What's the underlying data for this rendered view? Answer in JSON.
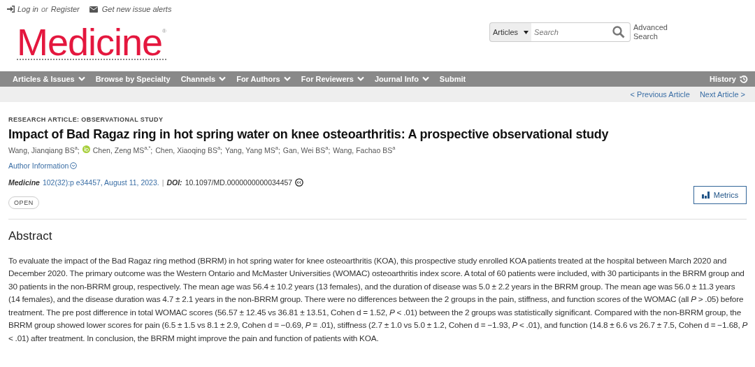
{
  "top_links": {
    "login": "Log in",
    "or": "or",
    "register": "Register",
    "alerts": "Get new issue alerts"
  },
  "logo": {
    "name": "Medicine",
    "mark": "®"
  },
  "search": {
    "scope": "Articles",
    "placeholder": "Search",
    "advanced": "Advanced Search"
  },
  "nav": {
    "items": [
      {
        "label": "Articles & Issues",
        "dropdown": true
      },
      {
        "label": "Browse by Specialty",
        "dropdown": false
      },
      {
        "label": "Channels",
        "dropdown": true
      },
      {
        "label": "For Authors",
        "dropdown": true
      },
      {
        "label": "For Reviewers",
        "dropdown": true
      },
      {
        "label": "Journal Info",
        "dropdown": true
      },
      {
        "label": "Submit",
        "dropdown": false
      }
    ],
    "history": "History"
  },
  "pager": {
    "previous": "< Previous Article",
    "next": "Next Article >"
  },
  "article": {
    "type": "RESEARCH ARTICLE: OBSERVATIONAL STUDY",
    "title": "Impact of Bad Ragaz ring in hot spring water on knee osteoarthritis: A prospective observational study",
    "authors": [
      {
        "name": "Wang, Jianqiang BS$^{a}$;",
        "orcid": false
      },
      {
        "name": "Chen, Zeng MS$^{a,*}$;",
        "orcid": true
      },
      {
        "name": "Chen, Xiaoqing BS$^{a}$;",
        "orcid": false
      },
      {
        "name": "Yang, Yang MS$^{a}$;",
        "orcid": false
      },
      {
        "name": "Gan, Wei BS$^{a}$;",
        "orcid": false
      },
      {
        "name": "Wang, Fachao BS$^{a}$",
        "orcid": false
      }
    ],
    "author_info": "Author Information",
    "journal": "Medicine",
    "citation": "102(32):p e34457, August 11, 2023.",
    "separator": "|",
    "doi_label": "DOI:",
    "doi": "10.1097/MD.0000000000034457",
    "access": "OPEN",
    "metrics": "Metrics"
  },
  "abstract": {
    "heading": "Abstract",
    "text": "To evaluate the impact of the Bad Ragaz ring method (BRRM) in hot spring water for knee osteoarthritis (KOA), this prospective study enrolled KOA patients treated at the hospital between March 2020 and December 2020. The primary outcome was the Western Ontario and McMaster Universities (WOMAC) osteoarthritis index score. A total of 60 patients were included, with 30 participants in the BRRM group and 30 patients in the non-BRRM group, respectively. The mean age was 56.4 ± 10.2 years (13 females), and the duration of disease was 5.0 ± 2.2 years in the BRRM group. The mean age was 56.0 ± 11.3 years (14 females), and the disease duration was 4.7 ± 2.1 years in the non-BRRM group. There were no differences between the 2 groups in the pain, stiffness, and function scores of the WOMAC (all *P* > .05) before treatment. The pre post difference in total WOMAC scores (56.57 ± 12.45 vs 36.81 ± 13.51, Cohen d = 1.52, *P* < .01) between the 2 groups was statistically significant. Compared with the non-BRRM group, the BRRM group showed lower scores for pain (6.5 ± 1.5 vs 8.1 ± 2.9, Cohen d = −0.69, *P* = .01), stiffness (2.7 ± 1.0 vs 5.0 ± 1.2, Cohen d = −1.93, *P* < .01), and function (14.8 ± 6.6 vs 26.7 ± 7.5, Cohen d = −1.68, *P* < .01) after treatment. In conclusion, the BRRM might improve the pain and function of patients with KOA."
  }
}
